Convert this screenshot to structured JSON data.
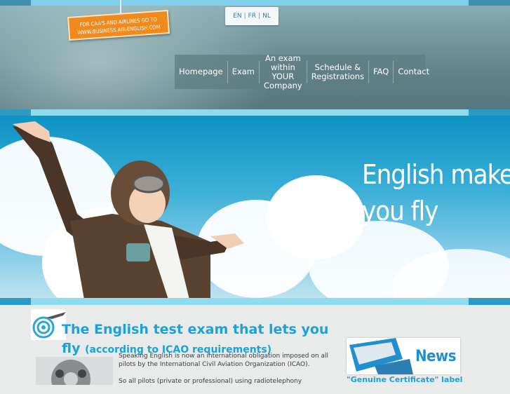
{
  "promo": {
    "line1": "FOR CAA'S AND AIRLINES GO TO",
    "line2": "WWW.BUSINESS.AIR-ENGLISH.COM"
  },
  "languages": {
    "en": "EN",
    "fr": "FR",
    "nl": "NL",
    "separator": "|"
  },
  "nav": {
    "items": [
      {
        "label": "Homepage"
      },
      {
        "label": "Exam"
      },
      {
        "label_line1": "An exam within",
        "label_line2": "YOUR Company"
      },
      {
        "label_line1": "Schedule &",
        "label_line2": "Registrations"
      },
      {
        "label": "FAQ"
      },
      {
        "label": "Contact"
      }
    ]
  },
  "banner": {
    "line1": "English makes",
    "line2": "you fly"
  },
  "main": {
    "title": "The English test exam that lets you fly",
    "subtitle": "(according to ICAO requirements)",
    "paragraph1": "Speaking English is now an international obligation imposed on all pilots by the International Civil Aviation Organization  (ICAO).",
    "paragraph2": "So all pilots  (private or professional) using radiotelephony"
  },
  "news": {
    "label": "News",
    "link": "\"Genuine Certificate\" label"
  },
  "colors": {
    "accent": "#1aa3d8",
    "promo": "#f08a1c",
    "header": "#5d8087"
  }
}
